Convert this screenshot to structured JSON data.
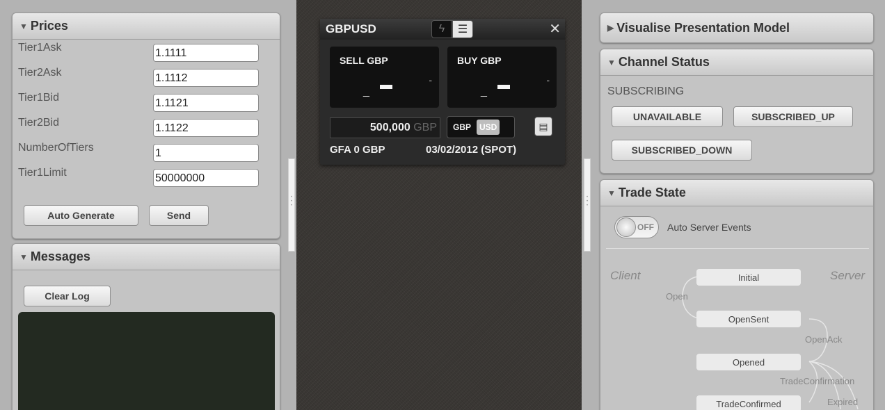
{
  "prices": {
    "title": "Prices",
    "fields": [
      {
        "label": "Tier1Ask",
        "value": "1.1111"
      },
      {
        "label": "Tier2Ask",
        "value": "1.1112"
      },
      {
        "label": "Tier1Bid",
        "value": "1.1121"
      },
      {
        "label": "Tier2Bid",
        "value": "1.1122"
      },
      {
        "label": "NumberOfTiers",
        "value": "1"
      },
      {
        "label": "Tier1Limit",
        "value": "50000000"
      }
    ],
    "auto_generate_label": "Auto Generate",
    "send_label": "Send"
  },
  "messages": {
    "title": "Messages",
    "clear_log_label": "Clear Log"
  },
  "tile": {
    "title": "GBPUSD",
    "sell_label": "SELL GBP",
    "buy_label": "BUY GBP",
    "sell_small": "-",
    "buy_small": "-",
    "sell_big": "_",
    "buy_big": "_",
    "notional_value": "500,000",
    "notional_ccy": "GBP",
    "ccy_options": [
      "GBP",
      "USD"
    ],
    "selected_ccy": "USD",
    "gfa": "GFA 0 GBP",
    "settlement": "03/02/2012 (SPOT)",
    "close_glyph": "✕",
    "menu_glyph": "▤"
  },
  "visualise": {
    "title": "Visualise Presentation Model"
  },
  "channel_status": {
    "title": "Channel Status",
    "status": "SUBSCRIBING",
    "buttons": [
      "UNAVAILABLE",
      "SUBSCRIBED_UP",
      "SUBSCRIBED_DOWN"
    ]
  },
  "trade_state": {
    "title": "Trade State",
    "toggle_state": "OFF",
    "toggle_label": "Auto Server Events",
    "client_label": "Client",
    "server_label": "Server",
    "states": [
      "Initial",
      "OpenSent",
      "Opened",
      "TradeConfirmed"
    ],
    "edges": [
      "Open",
      "OpenAck",
      "TradeConfirmation",
      "Expired"
    ]
  }
}
